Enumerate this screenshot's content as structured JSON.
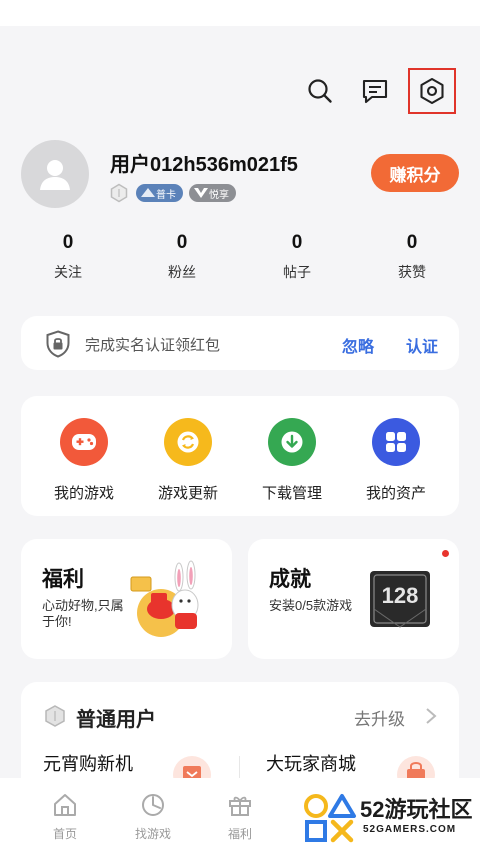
{
  "header": {
    "search_icon": "search-icon",
    "message_icon": "message-icon",
    "settings_icon": "settings-hexagon-icon"
  },
  "profile": {
    "username": "用户012h536m021f5",
    "badges": [
      {
        "icon": "level-hexagon-icon",
        "label": ""
      },
      {
        "icon": "card-badge-icon",
        "label": "普卡"
      },
      {
        "icon": "vip-badge-icon",
        "label": "悦享"
      }
    ],
    "earn_button": "赚积分"
  },
  "stats": [
    {
      "value": "0",
      "label": "关注"
    },
    {
      "value": "0",
      "label": "粉丝"
    },
    {
      "value": "0",
      "label": "帖子"
    },
    {
      "value": "0",
      "label": "获赞"
    }
  ],
  "verify": {
    "text": "完成实名认证领红包",
    "ignore_label": "忽略",
    "auth_label": "认证"
  },
  "quick_actions": [
    {
      "label": "我的游戏",
      "icon": "gamepad-icon",
      "color": "#f2593a"
    },
    {
      "label": "游戏更新",
      "icon": "refresh-icon",
      "color": "#f6b91c"
    },
    {
      "label": "下载管理",
      "icon": "download-icon",
      "color": "#35a852"
    },
    {
      "label": "我的资产",
      "icon": "grid-icon",
      "color": "#3b5ae0"
    }
  ],
  "promos": [
    {
      "title": "福利",
      "desc": "心动好物,只属于你!",
      "icon": "rabbit-mascot-icon"
    },
    {
      "title": "成就",
      "desc": "安装0/5款游戏",
      "icon": "achievement-128-icon",
      "badge_image_text": "128"
    }
  ],
  "membership": {
    "level": "普通用户",
    "upgrade": "去升级",
    "items": [
      "元宵购新机",
      "大玩家商城"
    ]
  },
  "bottom_nav": [
    {
      "label": "首页",
      "icon": "home-icon"
    },
    {
      "label": "找游戏",
      "icon": "find-game-icon"
    },
    {
      "label": "福利",
      "icon": "gift-icon"
    }
  ],
  "watermark": {
    "title": "52游玩社区",
    "subtitle": "52GAMERS.COM"
  },
  "colors": {
    "accent_orange": "#f26a36",
    "link_blue": "#3a6ee0",
    "highlight_red": "#e0342a"
  }
}
